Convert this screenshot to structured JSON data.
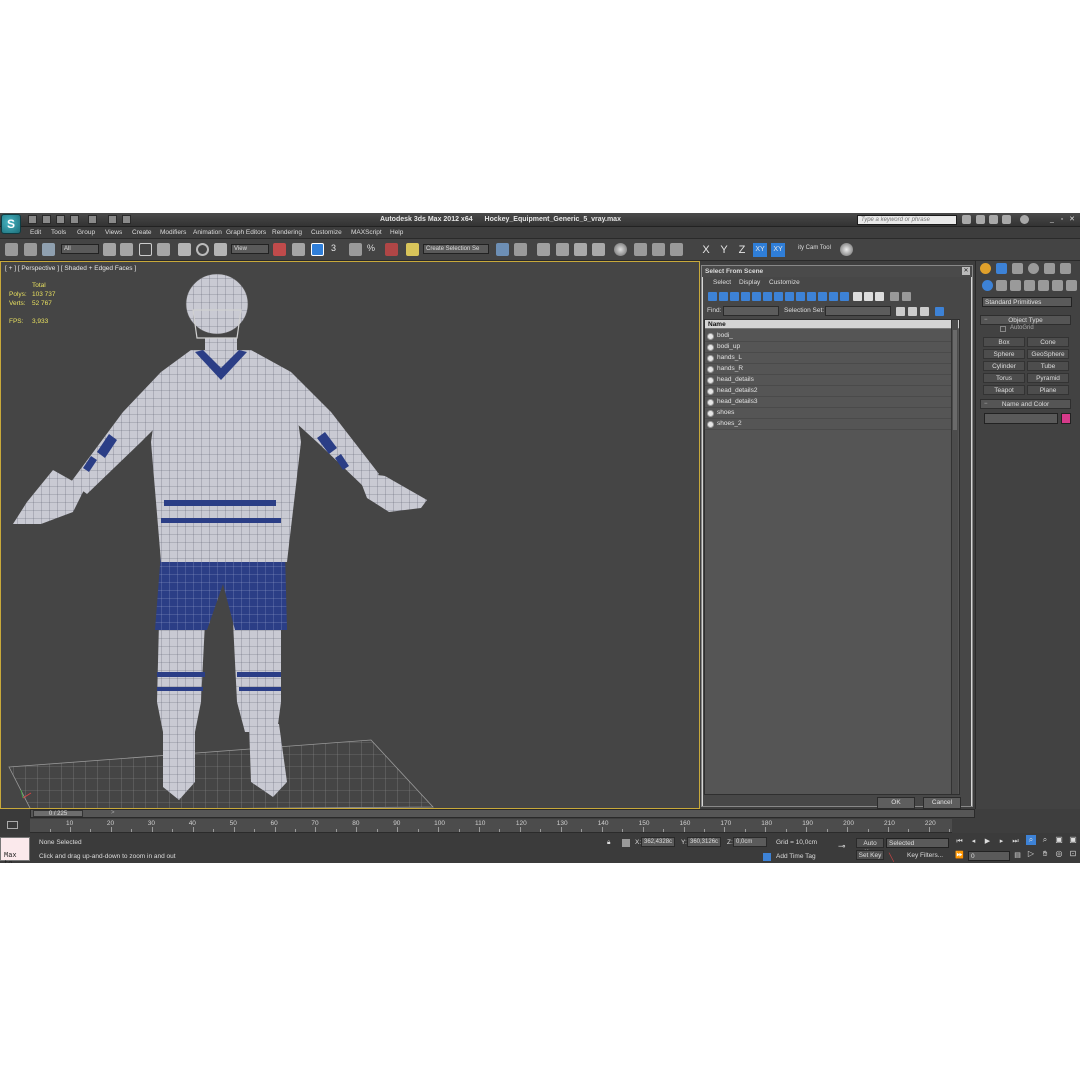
{
  "titlebar": {
    "app_title": "Autodesk 3ds Max  2012 x64",
    "file_name": "Hockey_Equipment_Generic_5_vray.max",
    "search_placeholder": "Type a keyword or phrase"
  },
  "menu": [
    "Edit",
    "Tools",
    "Group",
    "Views",
    "Create",
    "Modifiers",
    "Animation",
    "Graph Editors",
    "Rendering",
    "Customize",
    "MAXScript",
    "Help"
  ],
  "toolbar": {
    "selection_filter": "All",
    "reference_coord": "View",
    "snap_label": "3",
    "named_selection": "Create Selection Se",
    "axes": [
      "X",
      "Y",
      "Z",
      "XY",
      "XY"
    ],
    "cam_tool": "ity Cam Tool"
  },
  "viewport": {
    "label": "[ + ] [ Perspective ] [ Shaded + Edged Faces ]",
    "stats": {
      "total_label": "Total",
      "polys_label": "Polys:",
      "polys_value": "103 737",
      "verts_label": "Verts:",
      "verts_value": "52 767",
      "fps_label": "FPS:",
      "fps_value": "3,933"
    }
  },
  "dialog": {
    "title": "Select From Scene",
    "menu": [
      "Select",
      "Display",
      "Customize"
    ],
    "find_label": "Find:",
    "selection_set_label": "Selection Set:",
    "column_header": "Name",
    "items": [
      "bodi_",
      "bodi_up",
      "hands_L",
      "hands_R",
      "head_details",
      "head_details2",
      "head_details3",
      "shoes",
      "shoes_2"
    ],
    "ok_label": "OK",
    "cancel_label": "Cancel"
  },
  "command_panel": {
    "category": "Standard Primitives",
    "object_type_header": "Object Type",
    "autogrid_label": "AutoGrid",
    "buttons": [
      "Box",
      "Cone",
      "Sphere",
      "GeoSphere",
      "Cylinder",
      "Tube",
      "Torus",
      "Pyramid",
      "Teapot",
      "Plane"
    ],
    "name_color_header": "Name and Color",
    "swatch_color": "#d63a8a"
  },
  "timeline": {
    "position": "0 / 225",
    "ticks": [
      "10",
      "20",
      "30",
      "40",
      "50",
      "60",
      "70",
      "80",
      "90",
      "100",
      "110",
      "120",
      "130",
      "140",
      "150",
      "160",
      "170",
      "180",
      "190",
      "200",
      "210",
      "220"
    ]
  },
  "status": {
    "maxscript_label": "Max to",
    "selection_status": "None Selected",
    "prompt": "Click and drag up-and-down to zoom in and out",
    "x_label": "X:",
    "x_value": "362,4328c",
    "y_label": "Y:",
    "y_value": "360,3126c",
    "z_label": "Z:",
    "z_value": "0,0cm",
    "grid": "Grid = 10,0cm",
    "add_time_tag": "Add Time Tag",
    "auto_key": "Auto Key",
    "set_key": "Set Key",
    "key_mode": "Selected",
    "key_filters": "Key Filters...",
    "frame": "0"
  }
}
